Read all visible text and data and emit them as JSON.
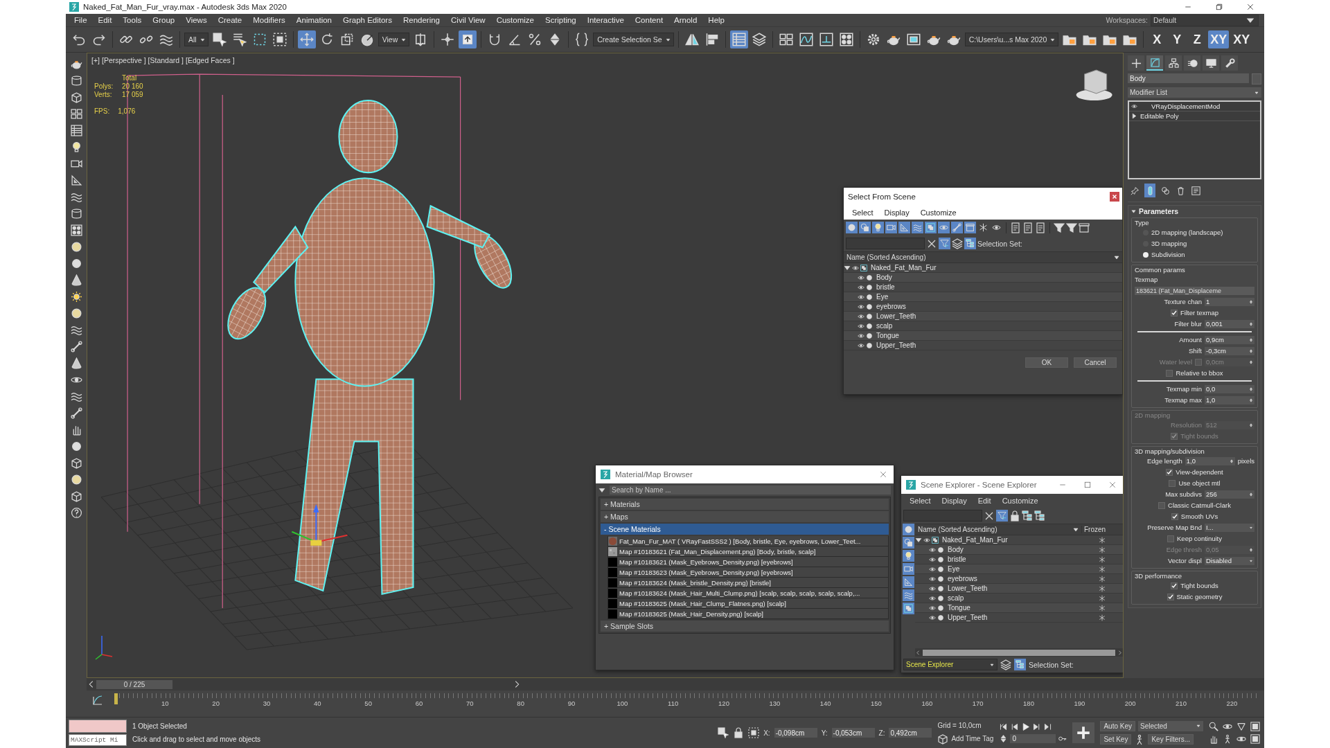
{
  "window": {
    "title": "Naked_Fat_Man_Fur_vray.max - Autodesk 3ds Max 2020"
  },
  "menu": [
    "File",
    "Edit",
    "Tools",
    "Group",
    "Views",
    "Create",
    "Modifiers",
    "Animation",
    "Graph Editors",
    "Rendering",
    "Civil View",
    "Customize",
    "Scripting",
    "Interactive",
    "Content",
    "Arnold",
    "Help"
  ],
  "workspace": {
    "label": "Workspaces:",
    "value": "Default"
  },
  "toolbar": [
    {
      "kind": "tool",
      "selected": false
    },
    {
      "kind": "tool",
      "selected": false
    },
    {
      "kind": "separator"
    },
    {
      "kind": "tool",
      "selected": false
    },
    {
      "kind": "tool",
      "selected": false
    },
    {
      "kind": "tool",
      "selected": false
    },
    {
      "kind": "separator"
    },
    {
      "kind": "dropdown",
      "value": "All"
    },
    {
      "kind": "tool",
      "selected": false
    },
    {
      "kind": "tool",
      "selected": false
    },
    {
      "kind": "tool",
      "selected": false
    },
    {
      "kind": "tool",
      "selected": false
    },
    {
      "kind": "separator"
    },
    {
      "kind": "tool",
      "selected": true
    },
    {
      "kind": "tool",
      "selected": false
    },
    {
      "kind": "tool",
      "selected": false
    },
    {
      "kind": "tool",
      "selected": false
    },
    {
      "kind": "dropdown",
      "value": "View"
    },
    {
      "kind": "tool",
      "selected": false
    },
    {
      "kind": "separator"
    },
    {
      "kind": "tool",
      "selected": false
    },
    {
      "kind": "tool",
      "selected": true
    },
    {
      "kind": "separator"
    },
    {
      "kind": "tool",
      "selected": false
    },
    {
      "kind": "tool",
      "selected": false
    },
    {
      "kind": "tool",
      "selected": false
    },
    {
      "kind": "tool",
      "selected": false
    },
    {
      "kind": "separator"
    },
    {
      "kind": "tool",
      "selected": false
    },
    {
      "kind": "dropdown",
      "value": "Create Selection Se"
    },
    {
      "kind": "separator"
    },
    {
      "kind": "tool",
      "selected": false
    },
    {
      "kind": "tool",
      "selected": false
    },
    {
      "kind": "separator"
    },
    {
      "kind": "tool",
      "selected": true
    },
    {
      "kind": "tool",
      "selected": false
    },
    {
      "kind": "separator"
    },
    {
      "kind": "tool",
      "selected": false
    },
    {
      "kind": "tool",
      "selected": false
    },
    {
      "kind": "tool",
      "selected": false
    },
    {
      "kind": "tool",
      "selected": false
    },
    {
      "kind": "separator"
    },
    {
      "kind": "tool",
      "selected": false
    },
    {
      "kind": "tool",
      "selected": false
    },
    {
      "kind": "tool",
      "selected": false
    },
    {
      "kind": "tool",
      "selected": false
    },
    {
      "kind": "tool",
      "selected": false
    },
    {
      "kind": "dropdown",
      "value": "C:\\Users\\u...s Max 2020"
    },
    {
      "kind": "tool",
      "selected": false
    },
    {
      "kind": "tool",
      "selected": false
    },
    {
      "kind": "tool",
      "selected": false
    },
    {
      "kind": "tool",
      "selected": false
    },
    {
      "kind": "separator"
    },
    {
      "kind": "text",
      "value": "X",
      "selected": false
    },
    {
      "kind": "text",
      "value": "Y",
      "selected": false
    },
    {
      "kind": "text",
      "value": "Z",
      "selected": false
    },
    {
      "kind": "text",
      "value": "XY",
      "selected": true
    },
    {
      "kind": "text",
      "value": "XY",
      "selected": false
    }
  ],
  "viewport": {
    "labels": [
      "[+]",
      "[Perspective ]",
      "[Standard ]",
      "[Edged Faces ]"
    ],
    "stats": [
      {
        "value": "Total"
      },
      {
        "label": "Polys:",
        "value": "20 160"
      },
      {
        "label": "Verts:",
        "value": "17 059"
      }
    ],
    "fps": {
      "label": "FPS:",
      "value": "1,076"
    }
  },
  "select_from_scene": {
    "title": "Select From Scene",
    "menu": [
      "Select",
      "Display",
      "Customize"
    ],
    "filters": [
      {
        "selected": true
      },
      {
        "selected": true
      },
      {
        "selected": true
      },
      {
        "selected": true
      },
      {
        "selected": true
      },
      {
        "selected": true
      },
      {
        "selected": true
      },
      {
        "selected": true
      },
      {
        "selected": true
      },
      {
        "selected": true
      },
      {
        "selected": false
      },
      {
        "selected": false
      }
    ],
    "selection_set_label": "Selection Set:",
    "column": "Name (Sorted Ascending)",
    "tree": {
      "name": "Naked_Fat_Man_Fur",
      "expanded": true,
      "children": [
        "Body",
        "bristle",
        "Eye",
        "eyebrows",
        "Lower_Teeth",
        "scalp",
        "Tongue",
        "Upper_Teeth"
      ]
    },
    "buttons": [
      "OK",
      "Cancel"
    ]
  },
  "material_browser": {
    "title": "Material/Map Browser",
    "search": {
      "placeholder": "Search by Name ..."
    },
    "sections": [
      {
        "sign": "+",
        "label": "Materials",
        "expanded": false
      },
      {
        "sign": "+",
        "label": "Maps",
        "expanded": false
      },
      {
        "sign": "-",
        "label": "Scene Materials",
        "expanded": true,
        "items": [
          {
            "kind": "sphere",
            "text": "Fat_Man_Fur_MAT  ( VRayFastSSS2 ) [Body, bristle, Eye, eyebrows, Lower_Teet..."
          },
          {
            "kind": "noise",
            "text": "Map #10183621 (Fat_Man_Displacement.png) [Body, bristle, scalp]"
          },
          {
            "kind": "black",
            "text": "Map #10183621 (Mask_Eyebrows_Density.png) [eyebrows]"
          },
          {
            "kind": "black",
            "text": "Map #10183623 (Mask_Eyebrows_Density.png) [eyebrows]"
          },
          {
            "kind": "black",
            "text": "Map #10183624 (Mask_bristle_Density.png) [bristle]"
          },
          {
            "kind": "black",
            "text": "Map #10183624 (Mask_Hair_Multi_Clump.png) [scalp, scalp, scalp, scalp, scalp,..."
          },
          {
            "kind": "black",
            "text": "Map #10183625 (Mask_Hair_Clump_Flatnes.png) [scalp]"
          },
          {
            "kind": "black",
            "text": "Map #10183625 (Mask_Hair_Density.png) [scalp]"
          }
        ]
      },
      {
        "sign": "+",
        "label": "Sample Slots",
        "expanded": false
      }
    ]
  },
  "scene_explorer": {
    "title": "Scene Explorer - Scene Explorer",
    "menu": [
      "Select",
      "Display",
      "Edit",
      "Customize"
    ],
    "filters": [
      {
        "selected": true
      },
      {
        "selected": true
      },
      {
        "selected": true
      },
      {
        "selected": true
      },
      {
        "selected": true
      },
      {
        "selected": true
      },
      {
        "selected": true
      }
    ],
    "columns": [
      "Name (Sorted Ascending)",
      "Frozen"
    ],
    "tree": {
      "name": "Naked_Fat_Man_Fur",
      "expanded": true,
      "children": [
        "Body",
        "bristle",
        "Eye",
        "eyebrows",
        "Lower_Teeth",
        "scalp",
        "Tongue",
        "Upper_Teeth"
      ]
    },
    "explorer_name": "Scene Explorer",
    "selection_set_label": "Selection Set:"
  },
  "command_panel": {
    "tabs": [
      {
        "selected": false
      },
      {
        "selected": true
      },
      {
        "selected": false
      },
      {
        "selected": false
      },
      {
        "selected": false
      },
      {
        "selected": false
      }
    ],
    "object_name": "Body",
    "modifier_list": "Modifier List",
    "stack": [
      {
        "kind": "modifier",
        "label": "VRayDisplacementMod"
      },
      {
        "kind": "base",
        "label": "Editable Poly"
      }
    ],
    "stack_tools": [
      {
        "selected": false
      },
      {
        "selected": true
      },
      {
        "selected": false
      },
      {
        "selected": false
      },
      {
        "selected": false
      }
    ],
    "rollout": {
      "title": "Parameters",
      "expanded": true,
      "groups": [
        {
          "title": "Type",
          "disabled": false,
          "rows": [
            {
              "kind": "radio",
              "label": "2D mapping (landscape)",
              "selected": false,
              "disabled": false
            },
            {
              "kind": "radio",
              "label": "3D mapping",
              "selected": false,
              "disabled": false
            },
            {
              "kind": "radio",
              "label": "Subdivision",
              "selected": true,
              "disabled": false
            }
          ]
        },
        {
          "title": "Common params",
          "disabled": false,
          "rows": [
            {
              "kind": "label",
              "label": "Texmap",
              "disabled": false
            },
            {
              "kind": "button",
              "value": "183621 (Fat_Man_Displaceme",
              "disabled": false
            },
            {
              "kind": "spinner",
              "label": "Texture chan",
              "value": "1",
              "disabled": false
            },
            {
              "kind": "checkbox",
              "label": "Filter texmap",
              "checked": true,
              "disabled": false
            },
            {
              "kind": "spinner",
              "label": "Filter blur",
              "value": "0,001",
              "disabled": false
            },
            {
              "kind": "rule"
            },
            {
              "kind": "spinner",
              "label": "Amount",
              "value": "0,9cm",
              "disabled": false
            },
            {
              "kind": "spinner",
              "label": "Shift",
              "value": "-0,3cm",
              "disabled": false
            },
            {
              "kind": "spinner",
              "label": "Water level",
              "value": "0,0cm",
              "checked": false,
              "disabled": true
            },
            {
              "kind": "checkbox",
              "label": "Relative to bbox",
              "checked": false,
              "disabled": false
            },
            {
              "kind": "rule"
            },
            {
              "kind": "spinner",
              "label": "Texmap min",
              "value": "0,0",
              "disabled": false
            },
            {
              "kind": "spinner",
              "label": "Texmap max",
              "value": "1,0",
              "disabled": false
            }
          ]
        },
        {
          "title": "2D mapping",
          "disabled": true,
          "rows": [
            {
              "kind": "spinner",
              "label": "Resolution",
              "value": "512",
              "disabled": true
            },
            {
              "kind": "checkbox",
              "label": "Tight bounds",
              "checked": true,
              "disabled": true
            }
          ]
        },
        {
          "title": "3D mapping/subdivision",
          "disabled": false,
          "rows": [
            {
              "kind": "spinner",
              "label": "Edge length",
              "value": "1,0",
              "suffix": "pixels",
              "disabled": false
            },
            {
              "kind": "checkbox",
              "label": "View-dependent",
              "checked": true,
              "disabled": false
            },
            {
              "kind": "checkbox",
              "label": "Use object mtl",
              "checked": false,
              "disabled": false
            },
            {
              "kind": "spinner",
              "label": "Max subdivs",
              "value": "256",
              "disabled": false
            },
            {
              "kind": "checkbox",
              "label": "Classic Catmull-Clark",
              "checked": false,
              "disabled": false
            },
            {
              "kind": "checkbox",
              "label": "Smooth UVs",
              "checked": true,
              "disabled": false
            },
            {
              "kind": "dropdown",
              "label": "Preserve Map Bnd",
              "value": "I...",
              "disabled": false
            },
            {
              "kind": "checkbox",
              "label": "Keep continuity",
              "checked": false,
              "disabled": false
            },
            {
              "kind": "spinner",
              "label": "Edge thresh",
              "value": "0,05",
              "disabled": true
            },
            {
              "kind": "dropdown",
              "label": "Vector displ",
              "value": "Disabled",
              "disabled": false
            }
          ]
        },
        {
          "title": "3D performance",
          "disabled": false,
          "rows": [
            {
              "kind": "checkbox",
              "label": "Tight bounds",
              "checked": true,
              "disabled": false
            },
            {
              "kind": "checkbox",
              "label": "Static geometry",
              "checked": true,
              "disabled": false
            }
          ]
        }
      ]
    }
  },
  "timeline": {
    "slider": "0 / 225",
    "ticks": [
      "10",
      "20",
      "30",
      "40",
      "50",
      "60",
      "70",
      "80",
      "90",
      "100",
      "110",
      "120",
      "130",
      "140",
      "150",
      "160",
      "170",
      "180",
      "190",
      "200",
      "210",
      "220"
    ]
  },
  "status": {
    "listener": "MAXScript Mi",
    "selection": "1 Object Selected",
    "prompt": "Click and drag to select and move objects",
    "coords": [
      {
        "label": "X:",
        "value": "-0,098cm"
      },
      {
        "label": "Y:",
        "value": "-0,053cm"
      },
      {
        "label": "Z:",
        "value": "0,492cm"
      }
    ],
    "grid": "Grid = 10,0cm",
    "time_tag": "Add Time Tag",
    "frame": "0",
    "auto_key": "Auto Key",
    "set_key": "Set Key",
    "key_mode": "Selected",
    "key_filters": "Key Filters..."
  }
}
